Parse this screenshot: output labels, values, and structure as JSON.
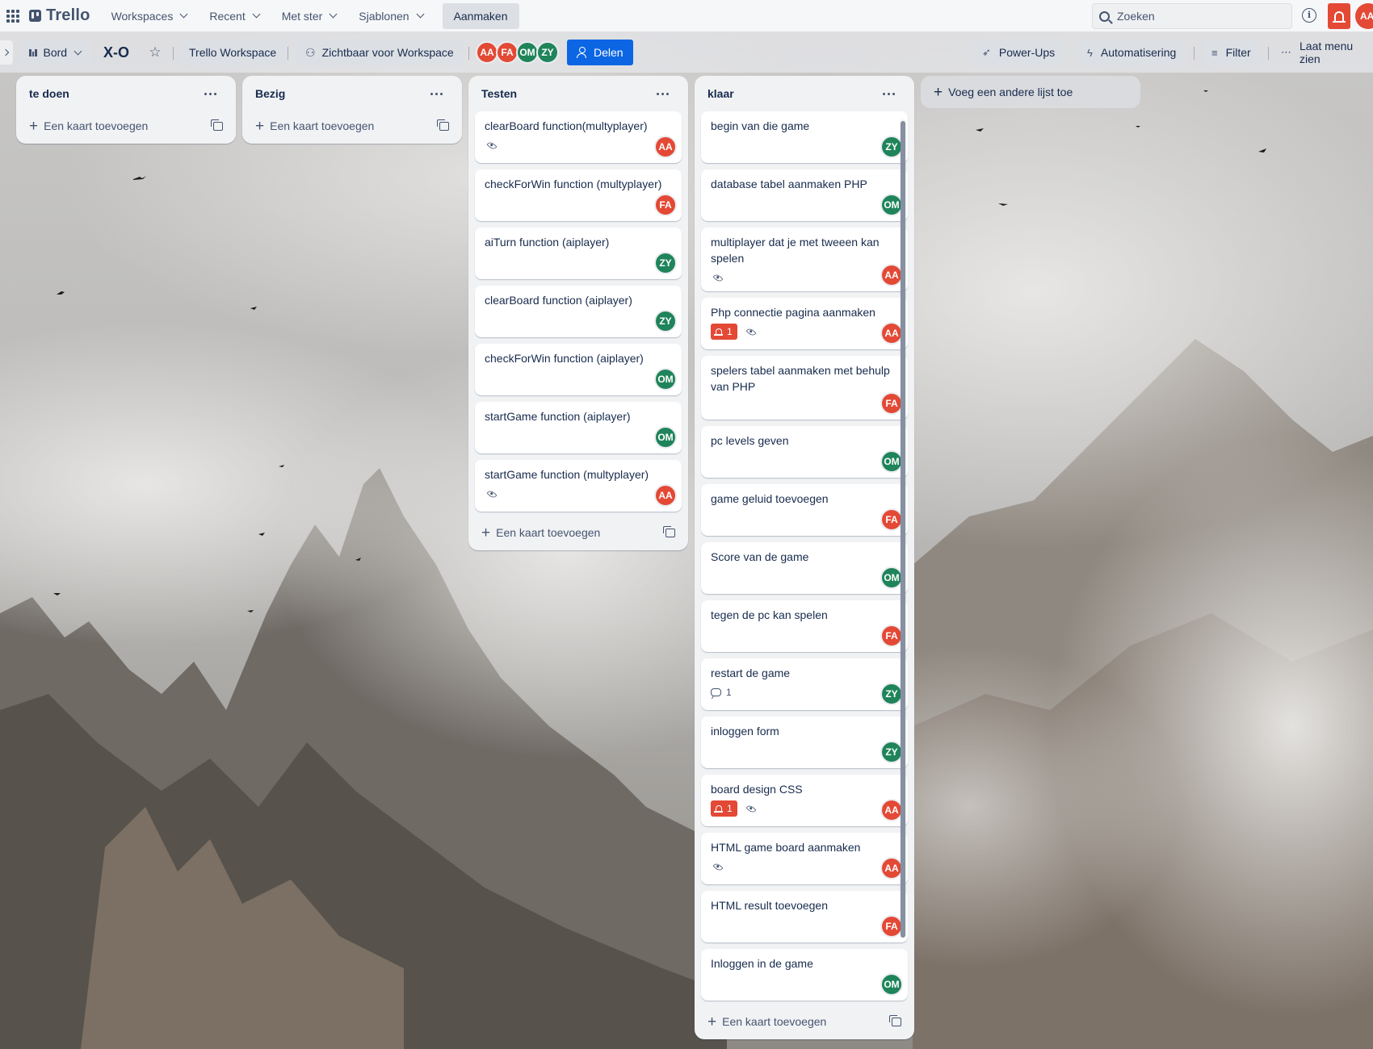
{
  "topbar": {
    "logo": "Trello",
    "nav": [
      "Workspaces",
      "Recent",
      "Met ster",
      "Sjablonen"
    ],
    "create_label": "Aanmaken",
    "search_placeholder": "Zoeken",
    "user_initials": "AA",
    "colors": {
      "notification": "#e34935",
      "accent": "#0c66e4"
    }
  },
  "board": {
    "view_label": "Bord",
    "title": "X-O",
    "workspace_label": "Trello Workspace",
    "visibility_label": "Zichtbaar voor Workspace",
    "members": [
      "AA",
      "FA",
      "OM",
      "ZY"
    ],
    "share_label": "Delen",
    "powerups_label": "Power-Ups",
    "automation_label": "Automatisering",
    "filter_label": "Filter",
    "menu_label": "Laat menu zien"
  },
  "lists": [
    {
      "title": "te doen",
      "cards": [],
      "add_card_label": "Een kaart toevoegen"
    },
    {
      "title": "Bezig",
      "cards": [],
      "add_card_label": "Een kaart toevoegen"
    },
    {
      "title": "Testen",
      "add_card_label": "Een kaart toevoegen",
      "cards": [
        {
          "title": "clearBoard function(multyplayer)",
          "member": "AA",
          "watch": true
        },
        {
          "title": "checkForWin function (multyplayer)",
          "member": "FA"
        },
        {
          "title": "aiTurn function (aiplayer)",
          "member": "ZY"
        },
        {
          "title": "clearBoard function (aiplayer)",
          "member": "ZY"
        },
        {
          "title": "checkForWin function (aiplayer)",
          "member": "OM"
        },
        {
          "title": "startGame function (aiplayer)",
          "member": "OM"
        },
        {
          "title": "startGame function (multyplayer)",
          "member": "AA",
          "watch": true
        }
      ]
    },
    {
      "title": "klaar",
      "add_card_label": "Een kaart toevoegen",
      "cards": [
        {
          "title": "begin van die game",
          "member": "ZY"
        },
        {
          "title": "database tabel aanmaken PHP",
          "member": "OM"
        },
        {
          "title": "multiplayer dat je met tweeen kan spelen",
          "member": "AA",
          "watch": true
        },
        {
          "title": "Php connectie pagina aanmaken",
          "member": "AA",
          "notifications": "1",
          "watch": true
        },
        {
          "title": "spelers tabel aanmaken met behulp van PHP",
          "member": "FA"
        },
        {
          "title": "pc levels geven",
          "member": "OM"
        },
        {
          "title": "game geluid toevoegen",
          "member": "FA"
        },
        {
          "title": "Score van de game",
          "member": "OM"
        },
        {
          "title": "tegen de pc kan spelen",
          "member": "FA"
        },
        {
          "title": "restart de game",
          "member": "ZY",
          "comments": "1"
        },
        {
          "title": "inloggen form",
          "member": "ZY"
        },
        {
          "title": "board design CSS",
          "member": "AA",
          "notifications": "1",
          "watch": true
        },
        {
          "title": "HTML game board aanmaken",
          "member": "AA",
          "watch": true
        },
        {
          "title": "HTML result toevoegen",
          "member": "FA"
        },
        {
          "title": "Inloggen in de game",
          "member": "OM"
        }
      ]
    }
  ],
  "add_list_label": "Voeg een andere lijst toe"
}
